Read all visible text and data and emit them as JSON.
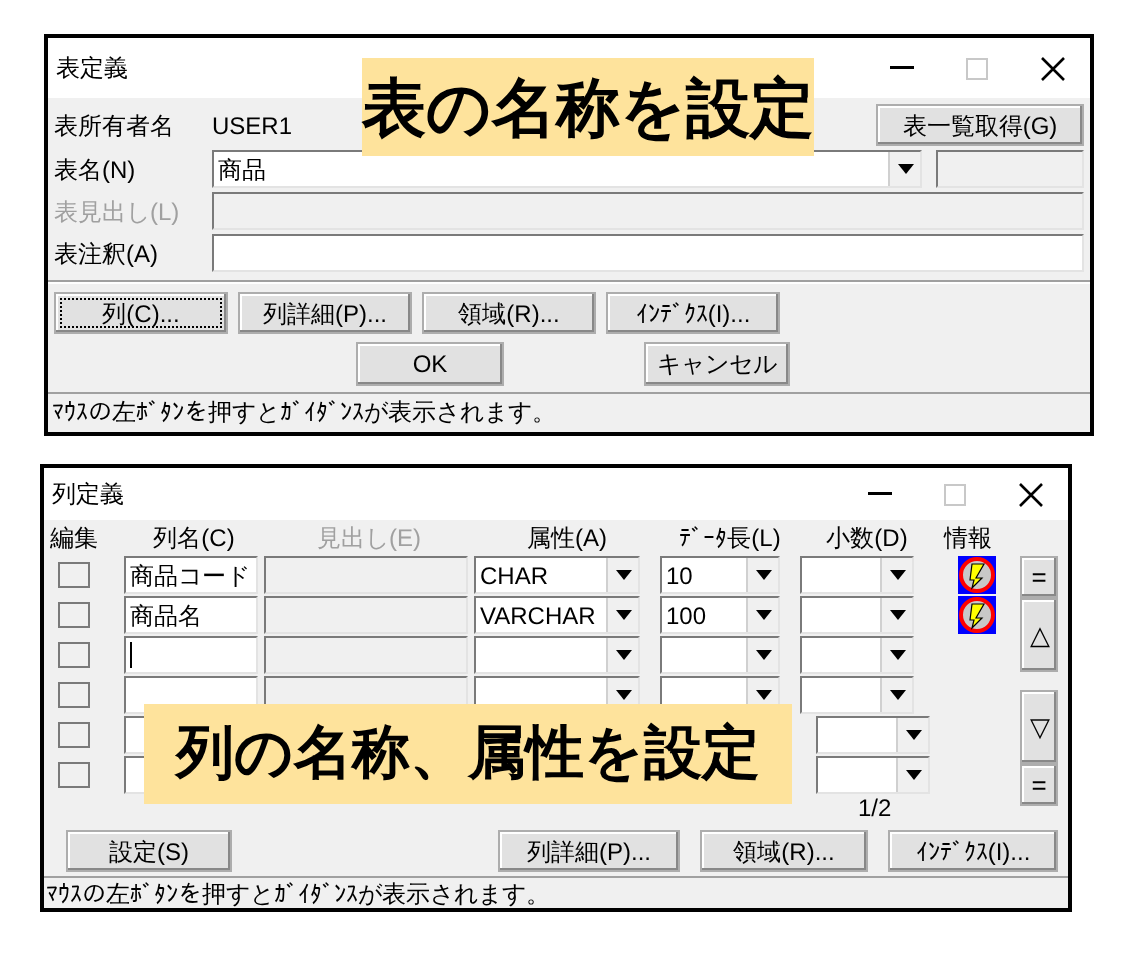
{
  "table_dialog": {
    "title": "表定義",
    "owner": {
      "label": "表所有者名",
      "value": "USER1"
    },
    "list_button": "表一覧取得(G)",
    "fields": [
      {
        "kind": "combo",
        "label": "表名(N)",
        "value": "商品",
        "disabled": false
      },
      {
        "kind": "text",
        "label": "表見出し(L)",
        "disabled": true
      },
      {
        "kind": "text",
        "label": "表注釈(A)",
        "disabled": false
      }
    ],
    "buttons": [
      {
        "label": "列(C)...",
        "focused": true
      },
      {
        "label": "列詳細(P)...",
        "focused": false
      },
      {
        "label": "領域(R)...",
        "focused": false
      },
      {
        "label": "ｲﾝﾃﾞｸｽ(I)...",
        "focused": false
      }
    ],
    "ok": "OK",
    "cancel": "キャンセル",
    "status": "ﾏｳｽの左ﾎﾞﾀﾝを押すとｶﾞｲﾀﾞﾝｽが表示されます。",
    "annotation": "表の名称を設定"
  },
  "column_dialog": {
    "title": "列定義",
    "columns": [
      {
        "label": "編集",
        "disabled": false
      },
      {
        "label": "列名(C)",
        "disabled": false
      },
      {
        "label": "見出し(E)",
        "disabled": true
      },
      {
        "label": "属性(A)",
        "disabled": false
      },
      {
        "label": "ﾃﾞｰﾀ長(L)",
        "disabled": false
      },
      {
        "label": "小数(D)",
        "disabled": false
      },
      {
        "label": "情報",
        "disabled": false
      }
    ],
    "rows": [
      {
        "checked": false,
        "name": "商品コード",
        "type": "CHAR",
        "length": "10",
        "info": true,
        "focused": false
      },
      {
        "checked": false,
        "name": "商品名",
        "type": "VARCHAR",
        "length": "100",
        "info": true,
        "focused": false
      },
      {
        "checked": false,
        "info": false,
        "focused": true
      },
      {
        "checked": false,
        "info": false,
        "focused": false
      },
      {
        "checked": false,
        "info": false,
        "focused": false,
        "covered": true
      },
      {
        "checked": false,
        "info": false,
        "focused": false,
        "covered": true
      }
    ],
    "side_buttons": [
      "=",
      "△",
      "▽",
      "="
    ],
    "page": "1/2",
    "set_button": "設定(S)",
    "buttons": [
      "列詳細(P)...",
      "領域(R)...",
      "ｲﾝﾃﾞｸｽ(I)..."
    ],
    "status": "ﾏｳｽの左ﾎﾞﾀﾝを押すとｶﾞｲﾀﾞﾝｽが表示されます。",
    "annotation": "列の名称、属性を設定"
  }
}
